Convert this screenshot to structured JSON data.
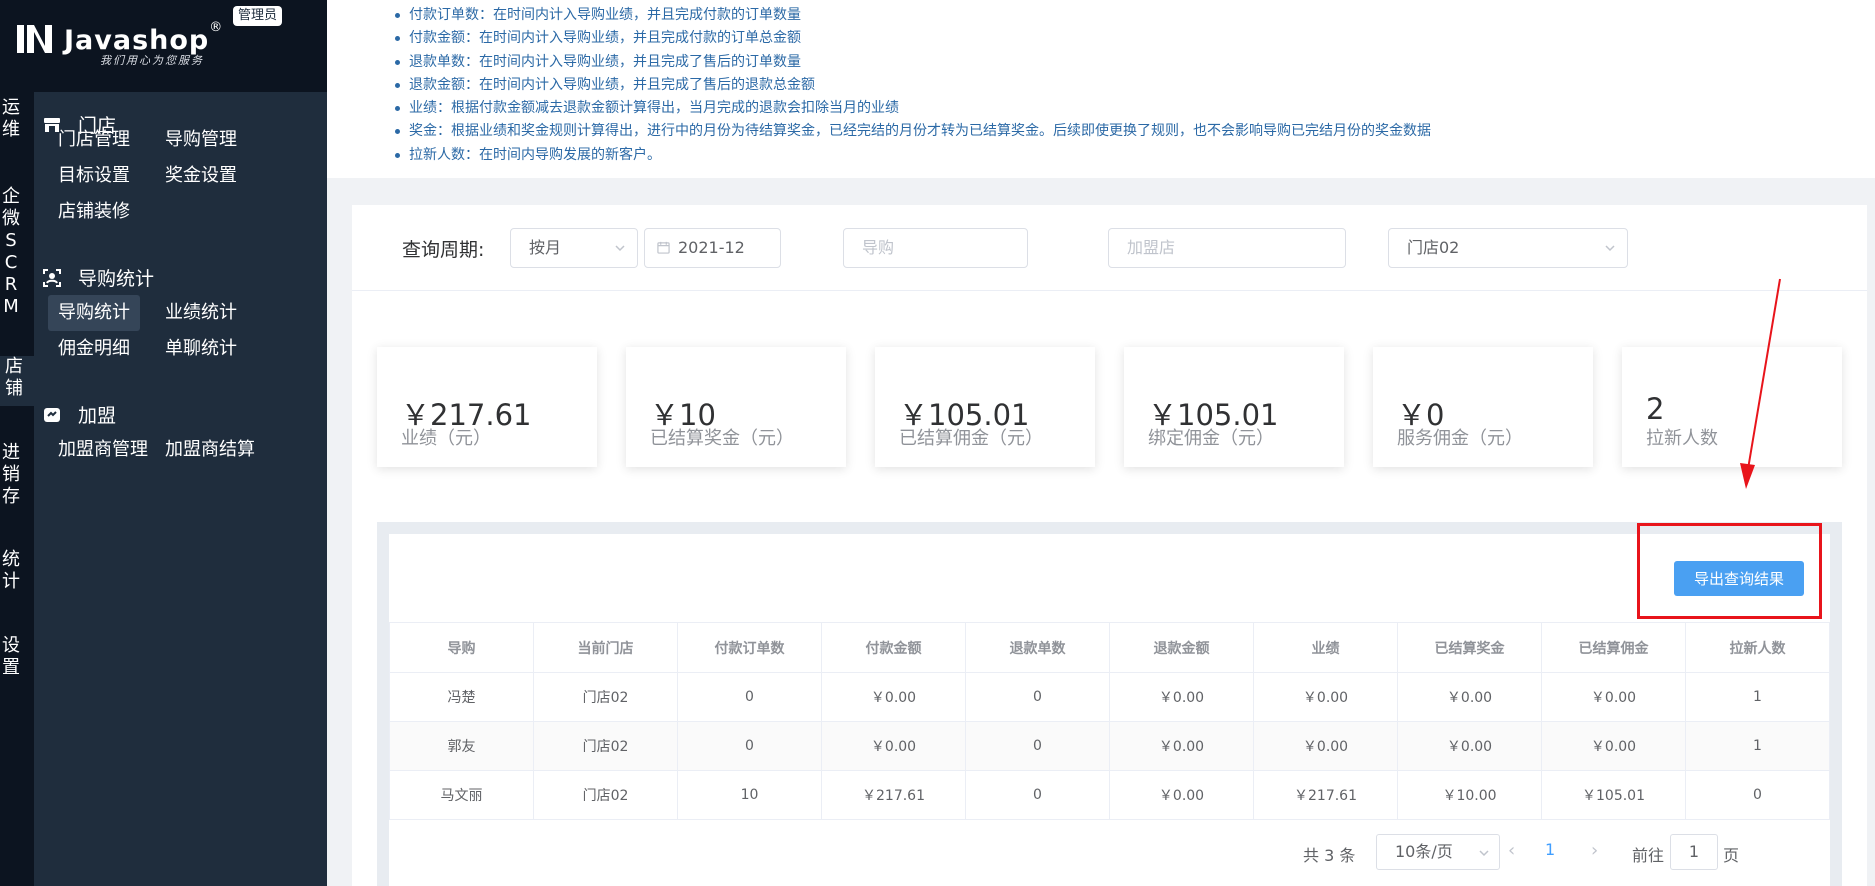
{
  "logo": {
    "brand": "Javashop",
    "registered": "®",
    "tagline": "我们用心为您服务",
    "admin_badge": "管理员"
  },
  "categories": [
    {
      "chars": [
        "运",
        "维"
      ]
    },
    {
      "chars": [
        "企",
        "微",
        "S",
        "C",
        "R",
        "M"
      ]
    },
    {
      "chars": [
        "店",
        "铺"
      ]
    },
    {
      "chars": [
        "进",
        "销",
        "存"
      ]
    },
    {
      "chars": [
        "统",
        "计"
      ]
    },
    {
      "chars": [
        "设",
        "置"
      ]
    }
  ],
  "sidebar": {
    "sections": [
      {
        "title": "门店",
        "icon": "store-icon",
        "items": [
          "门店管理",
          "导购管理",
          "目标设置",
          "奖金设置",
          "店铺装修"
        ]
      },
      {
        "title": "导购统计",
        "icon": "guide-stats-icon",
        "items": [
          "导购统计",
          "业绩统计",
          "佣金明细",
          "单聊统计"
        ],
        "active": "导购统计"
      },
      {
        "title": "加盟",
        "icon": "franchise-icon",
        "items": [
          "加盟商管理",
          "加盟商结算"
        ]
      }
    ]
  },
  "notes": [
    "付款订单数：在时间内计入导购业绩，并且完成付款的订单数量",
    "付款金额：在时间内计入导购业绩，并且完成付款的订单总金额",
    "退款单数：在时间内计入导购业绩，并且完成了售后的订单数量",
    "退款金额：在时间内计入导购业绩，并且完成了售后的退款总金额",
    "业绩：根据付款金额减去退款金额计算得出，当月完成的退款会扣除当月的业绩",
    "奖金：根据业绩和奖金规则计算得出，进行中的月份为待结算奖金，已经完结的月份才转为已结算奖金。后续即使更换了规则，也不会影响导购已完结月份的奖金数据",
    "拉新人数：在时间内导购发展的新客户。"
  ],
  "filter": {
    "label": "查询周期:",
    "period": "按月",
    "date": "2021-12",
    "guide_placeholder": "导购",
    "franchise_placeholder": "加盟店",
    "store": "门店02"
  },
  "summary_cards": [
    {
      "value": "￥217.61",
      "label": "业绩（元）"
    },
    {
      "value": "￥10",
      "label": "已结算奖金（元）"
    },
    {
      "value": "￥105.01",
      "label": "已结算佣金（元）"
    },
    {
      "value": "￥105.01",
      "label": "绑定佣金（元）"
    },
    {
      "value": "￥0",
      "label": "服务佣金（元）"
    },
    {
      "value": "2",
      "label": "拉新人数"
    }
  ],
  "export_button": "导出查询结果",
  "table": {
    "headers": [
      "导购",
      "当前门店",
      "付款订单数",
      "付款金额",
      "退款单数",
      "退款金额",
      "业绩",
      "已结算奖金",
      "已结算佣金",
      "拉新人数"
    ],
    "rows": [
      [
        "冯楚",
        "门店02",
        "0",
        "￥0.00",
        "0",
        "￥0.00",
        "￥0.00",
        "￥0.00",
        "￥0.00",
        "1"
      ],
      [
        "郭友",
        "门店02",
        "0",
        "￥0.00",
        "0",
        "￥0.00",
        "￥0.00",
        "￥0.00",
        "￥0.00",
        "1"
      ],
      [
        "马文丽",
        "门店02",
        "10",
        "￥217.61",
        "0",
        "￥0.00",
        "￥217.61",
        "￥10.00",
        "￥105.01",
        "0"
      ]
    ]
  },
  "pagination": {
    "total": "共 3 条",
    "page_size": "10条/页",
    "current": "1",
    "goto_label": "前往",
    "goto_value": "1",
    "page_unit": "页"
  },
  "colors": {
    "sidebar_bg": "#1f2d3d",
    "primary": "#409eff",
    "note_text": "#2b69a6",
    "highlight": "#e8141b"
  }
}
